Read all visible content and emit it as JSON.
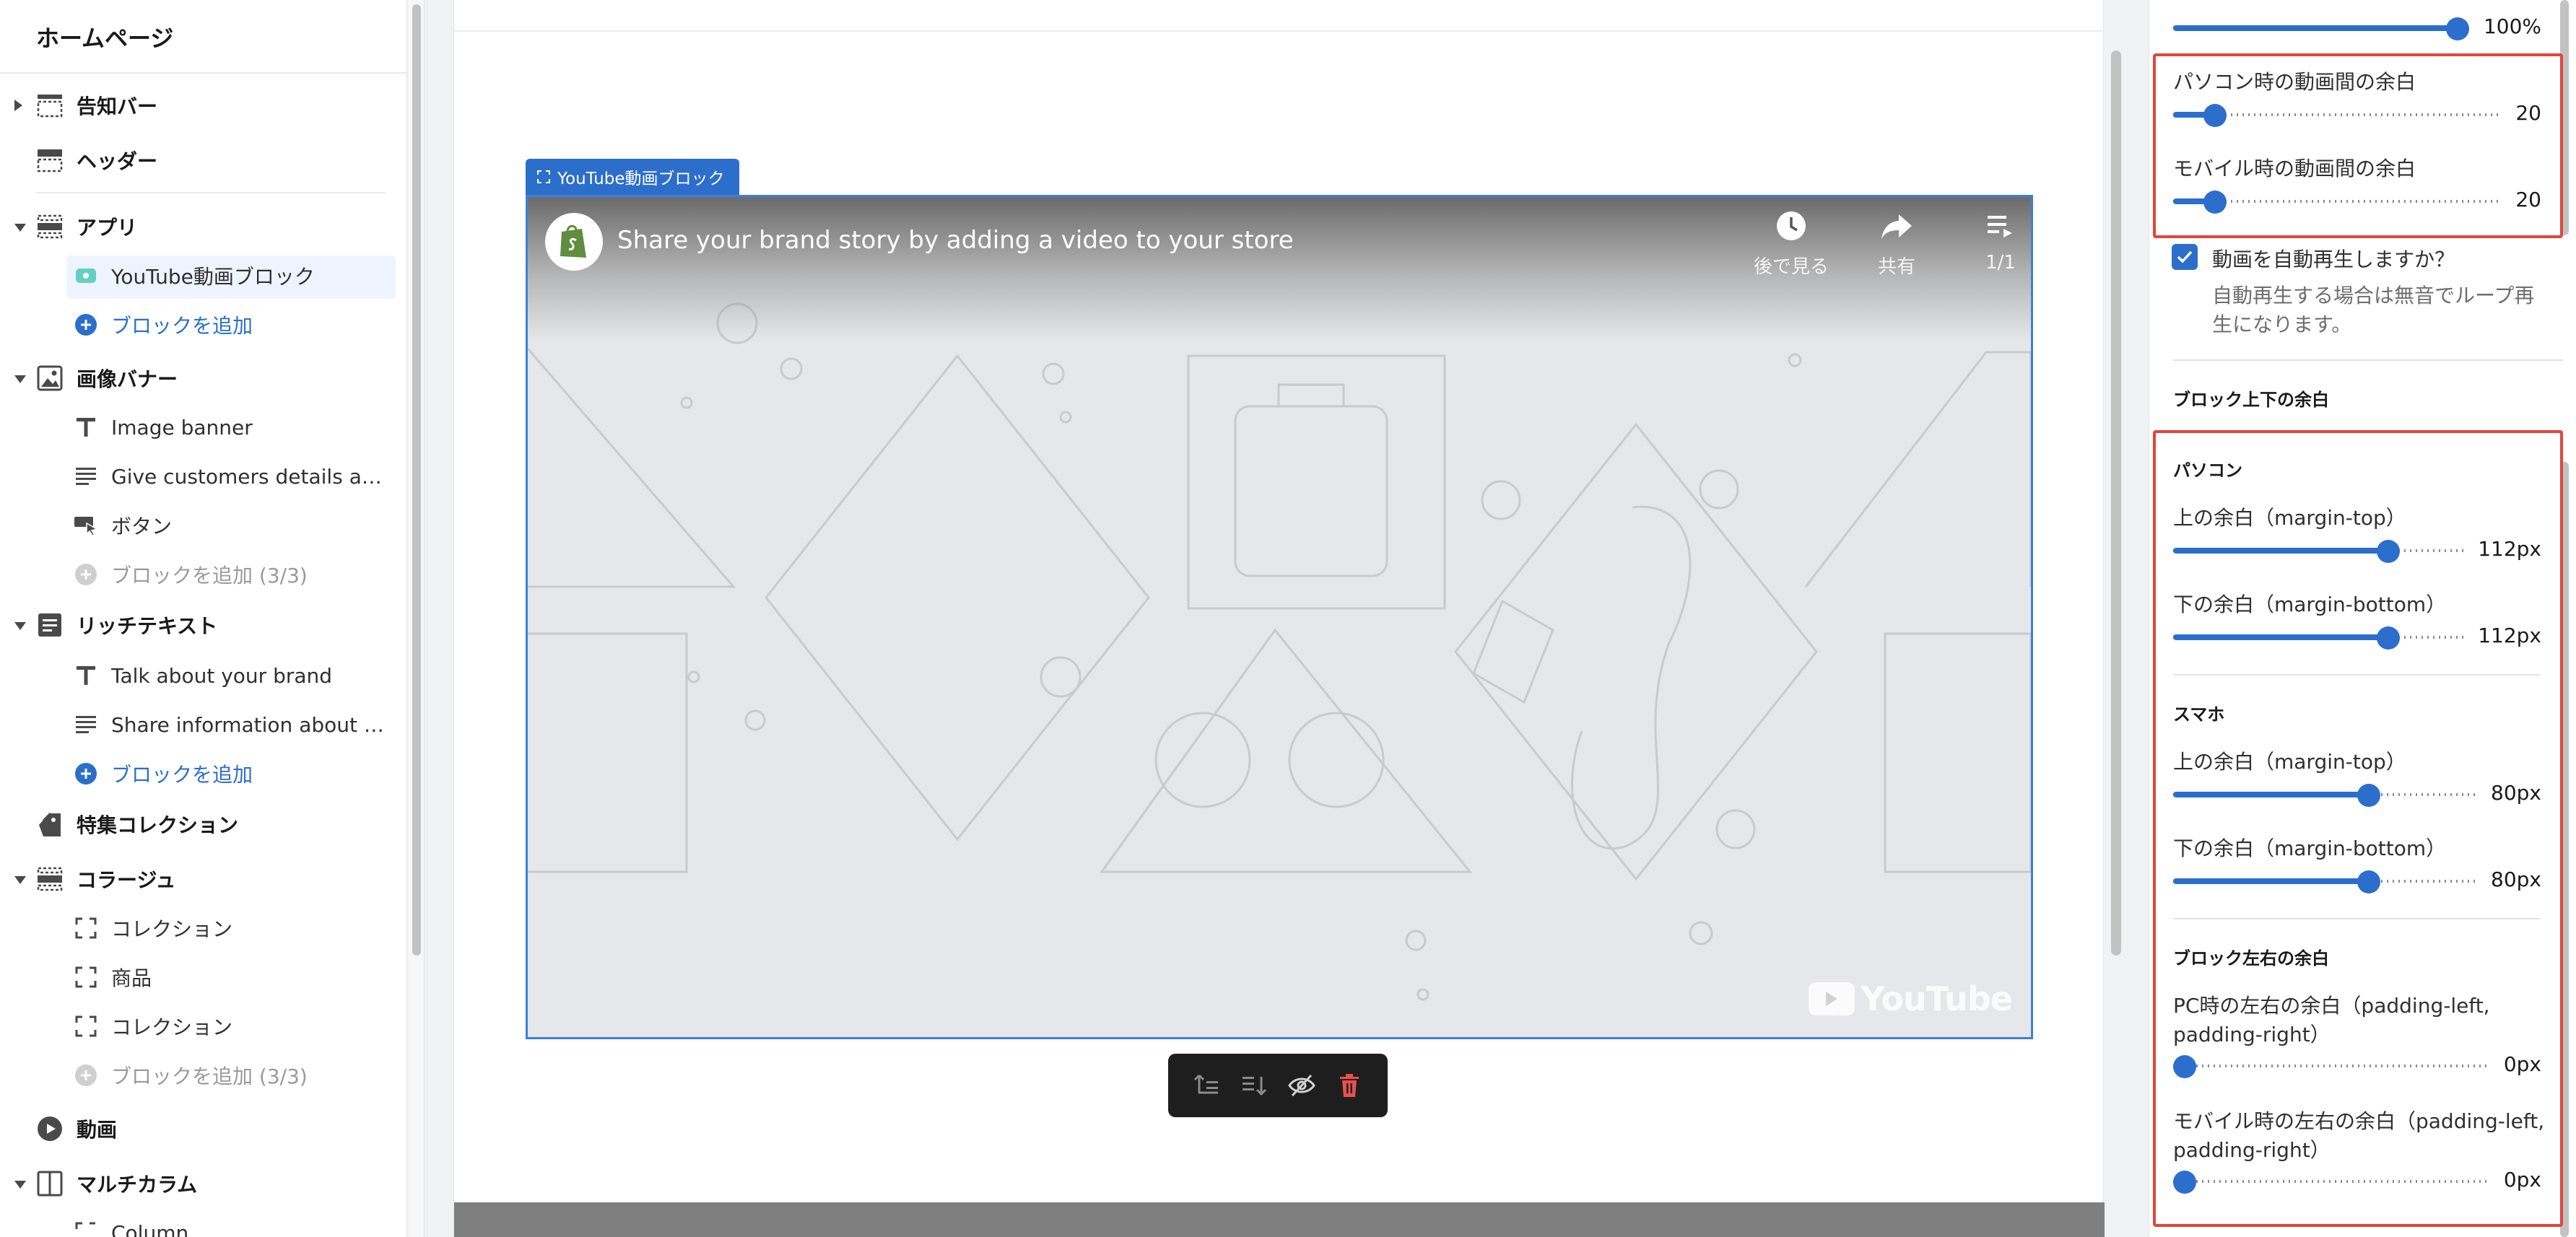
{
  "sidebar": {
    "title": "ホームページ",
    "sections": [
      {
        "label": "告知バー",
        "icon": "section-dashed-icon"
      },
      {
        "label": "ヘッダー",
        "icon": "header-icon"
      },
      {
        "label": "アプリ",
        "icon": "section-dashed-icon"
      },
      {
        "label": "画像バナー",
        "icon": "image-icon"
      },
      {
        "label": "リッチテキスト",
        "icon": "text-block-icon"
      },
      {
        "label": "特集コレクション",
        "icon": "tag-icon"
      },
      {
        "label": "コラージュ",
        "icon": "section-dashed-icon"
      },
      {
        "label": "動画",
        "icon": "play-circle-icon"
      },
      {
        "label": "マルチカラム",
        "icon": "columns-icon"
      }
    ],
    "app_children": [
      "YouTube動画ブロック",
      "ブロックを追加"
    ],
    "banner_children": [
      "Image banner",
      "Give customers details abou...",
      "ボタン",
      "ブロックを追加 (3/3)"
    ],
    "richtext_children": [
      "Talk about your brand",
      "Share information about you...",
      "ブロックを追加"
    ],
    "collage_children": [
      "コレクション",
      "商品",
      "コレクション",
      "ブロックを追加 (3/3)"
    ],
    "multicolumn_children": [
      "Column"
    ]
  },
  "preview": {
    "block_tag": "YouTube動画ブロック",
    "video_title": "Share your brand story by adding a video to your store",
    "controls": [
      "後で見る",
      "共有",
      "1/1"
    ],
    "youtube_wordmark": "YouTube"
  },
  "settings": {
    "top_value": "100%",
    "pc_gap_label": "パソコン時の動画間の余白",
    "pc_gap_value": "20",
    "pc_gap_level": 0.1,
    "mobile_gap_label": "モバイル時の動画間の余白",
    "mobile_gap_value": "20",
    "mobile_gap_level": 0.1,
    "autoplay_label": "動画を自動再生しますか？",
    "autoplay_help_1": "自動再生する場合は無音でループ再",
    "autoplay_help_2": "生になります。",
    "autoplay_checked": true,
    "block_vertical_heading": "ブロック上下の余白",
    "pc_heading": "パソコン",
    "pc_top_label": "上の余白（margin-top）",
    "pc_top_value": "112px",
    "pc_top_level": 0.75,
    "pc_bottom_label": "下の余白（margin-bottom）",
    "pc_bottom_value": "112px",
    "pc_bottom_level": 0.75,
    "sp_heading": "スマホ",
    "sp_top_label": "上の余白（margin-top）",
    "sp_top_value": "80px",
    "sp_top_level": 0.65,
    "sp_bottom_label": "下の余白（margin-bottom）",
    "sp_bottom_value": "80px",
    "sp_bottom_level": 0.65,
    "block_horizontal_heading": "ブロック左右の余白",
    "pc_lr_label_1": "PC時の左右の余白（padding-left,",
    "pc_lr_label_2": "padding-right）",
    "pc_lr_value": "0px",
    "pc_lr_level": 0.0,
    "mobile_lr_label_1": "モバイル時の左右の余白（padding-left,",
    "mobile_lr_label_2": "padding-right）",
    "mobile_lr_value": "0px",
    "mobile_lr_level": 0.0
  },
  "colors": {
    "accent": "#2c6ecb",
    "highlight_box": "#e0463b",
    "action_bar": "#1e1e1e",
    "delete": "#e85050"
  }
}
